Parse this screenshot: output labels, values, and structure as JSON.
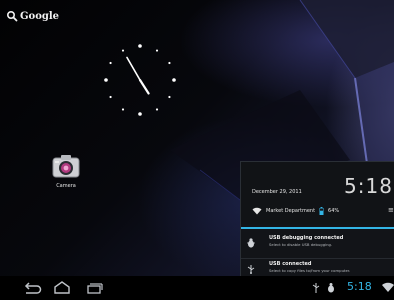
{
  "search": {
    "label": "Google"
  },
  "clock": {
    "hour": 4,
    "minute": 55
  },
  "apps": [
    {
      "name": "Camera",
      "icon": "camera-icon"
    }
  ],
  "notification_panel": {
    "date": "December 29, 2011",
    "time": "5:18",
    "network_name": "Market Department",
    "battery_percent": "64%",
    "notifications": [
      {
        "title": "USB debugging connected",
        "subtitle": "Select to disable USB debugging.",
        "icon": "bug-icon"
      },
      {
        "title": "USB connected",
        "subtitle": "Select to copy files to/from your computer.",
        "icon": "usb-icon"
      }
    ]
  },
  "nav_bar": {
    "buttons": [
      "back-icon",
      "home-icon",
      "recent-apps-icon"
    ],
    "status_icons": [
      "usb-icon",
      "bug-icon",
      "wifi-icon"
    ],
    "time": "5:18"
  },
  "colors": {
    "accent": "#33b5e5",
    "background": "#000000",
    "panel": "#121418"
  }
}
